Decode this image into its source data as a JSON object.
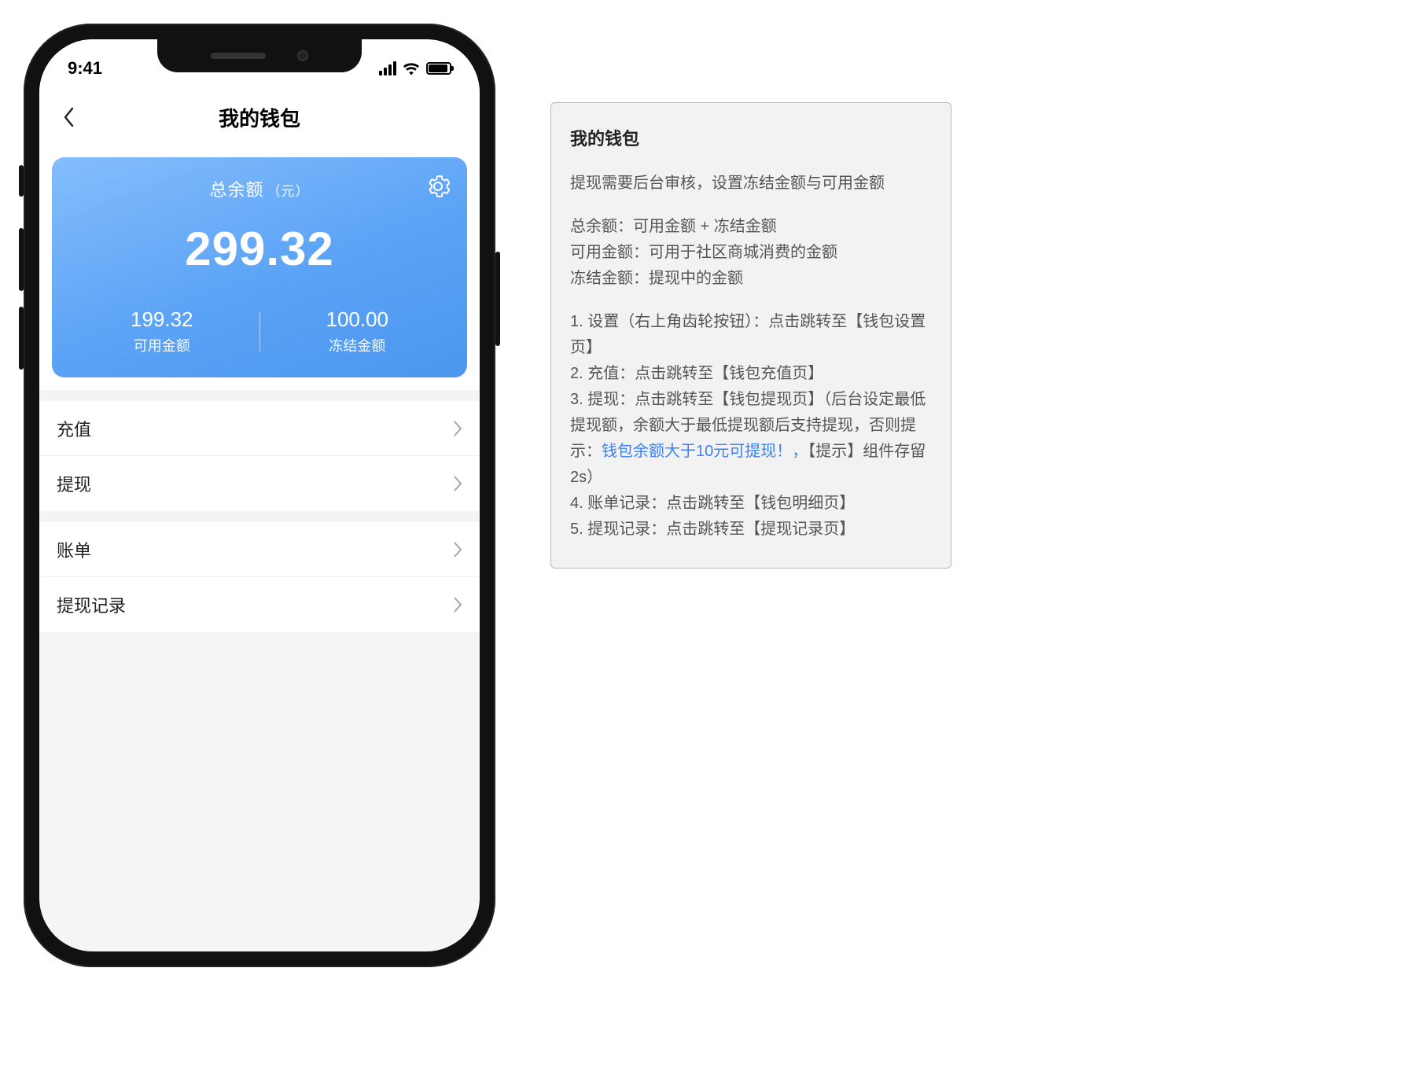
{
  "status": {
    "time": "9:41"
  },
  "nav": {
    "title": "我的钱包"
  },
  "balance": {
    "title": "总余额",
    "title_suffix": "（元）",
    "total": "299.32",
    "available_amount": "199.32",
    "available_label": "可用金额",
    "frozen_amount": "100.00",
    "frozen_label": "冻结金额"
  },
  "menu": {
    "group1": {
      "recharge": "充值",
      "withdraw": "提现"
    },
    "group2": {
      "bill": "账单",
      "withdraw_record": "提现记录"
    }
  },
  "annotation": {
    "heading": "我的钱包",
    "intro": "提现需要后台审核，设置冻结金额与可用金额",
    "def1": "总余额：可用金额 + 冻结金额",
    "def2": "可用金额：可用于社区商城消费的金额",
    "def3": "冻结金额：提现中的金额",
    "s1": "1. 设置（右上角齿轮按钮）：点击跳转至【钱包设置页】",
    "s2": "2. 充值：点击跳转至【钱包充值页】",
    "s3a": "3. 提现：点击跳转至【钱包提现页】（后台设定最低提现额，余额大于最低提现额后支持提现，否则提示：",
    "s3link": "钱包余额大于10元可提现！，",
    "s3b": "【提示】组件存留2s）",
    "s4": "4. 账单记录：点击跳转至【钱包明细页】",
    "s5": "5. 提现记录：点击跳转至【提现记录页】"
  }
}
